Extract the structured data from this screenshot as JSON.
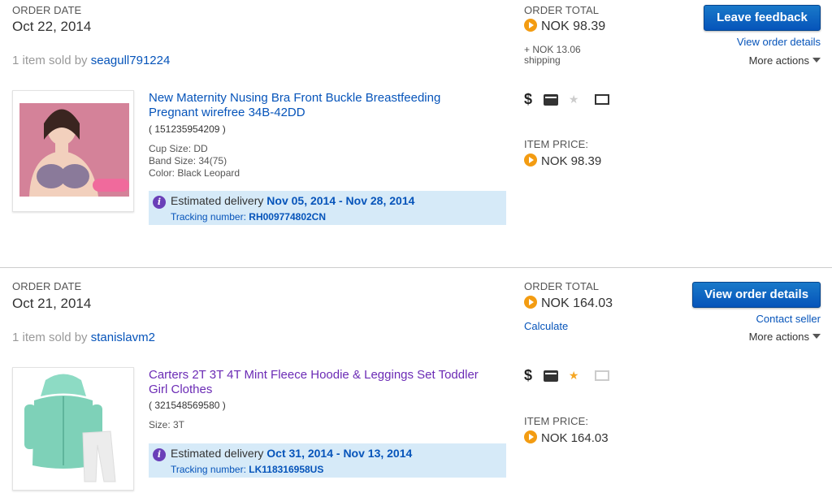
{
  "orders": [
    {
      "order_date_label": "ORDER DATE",
      "order_date": "Oct 22, 2014",
      "sold_prefix": "1 item sold by",
      "seller": "seagull791224",
      "order_total_label": "ORDER TOTAL",
      "order_total": "NOK 98.39",
      "shipping_line1": "+ NOK 13.06",
      "shipping_line2": "shipping",
      "primary_button": "Leave feedback",
      "secondary_link": "View order details",
      "more_actions": "More actions",
      "item": {
        "title": "New Maternity Nusing Bra Front Buckle Breastfeeding Pregnant wirefree 34B-42DD",
        "id": "( 151235954209 )",
        "specs": [
          "Cup Size: DD",
          "Band Size: 34(75)",
          "Color: Black Leopard"
        ],
        "delivery_prefix": "Estimated delivery",
        "delivery_range": "Nov 05, 2014 - Nov 28, 2014",
        "tracking_label": "Tracking number:",
        "tracking_number": "RH009774802CN",
        "price_label": "ITEM PRICE:",
        "price": "NOK 98.39",
        "icons": [
          "dollar-icon",
          "payment-icon",
          "feedback-star-icon",
          "shipped-envelope-icon"
        ]
      }
    },
    {
      "order_date_label": "ORDER DATE",
      "order_date": "Oct 21, 2014",
      "sold_prefix": "1 item sold by",
      "seller": "stanislavm2",
      "order_total_label": "ORDER TOTAL",
      "order_total": "NOK 164.03",
      "calculate_link": "Calculate",
      "primary_button": "View order details",
      "secondary_link": "Contact seller",
      "more_actions": "More actions",
      "item": {
        "title": "Carters 2T 3T 4T Mint Fleece Hoodie & Leggings Set Toddler Girl Clothes",
        "id": "( 321548569580 )",
        "specs": [
          "Size: 3T"
        ],
        "delivery_prefix": "Estimated delivery",
        "delivery_range": "Oct 31, 2014 - Nov 13, 2014",
        "tracking_label": "Tracking number:",
        "tracking_number": "LK118316958US",
        "price_label": "ITEM PRICE:",
        "price": "NOK 164.03",
        "icons": [
          "dollar-icon",
          "payment-icon",
          "feedback-star-icon",
          "envelope-icon"
        ]
      }
    }
  ],
  "colors": {
    "link": "#0654ba",
    "visited": "#6b2bb5",
    "button": "#0654ba",
    "delivery_bg": "#d6eaf8",
    "paypal_orange": "#f39c12"
  }
}
